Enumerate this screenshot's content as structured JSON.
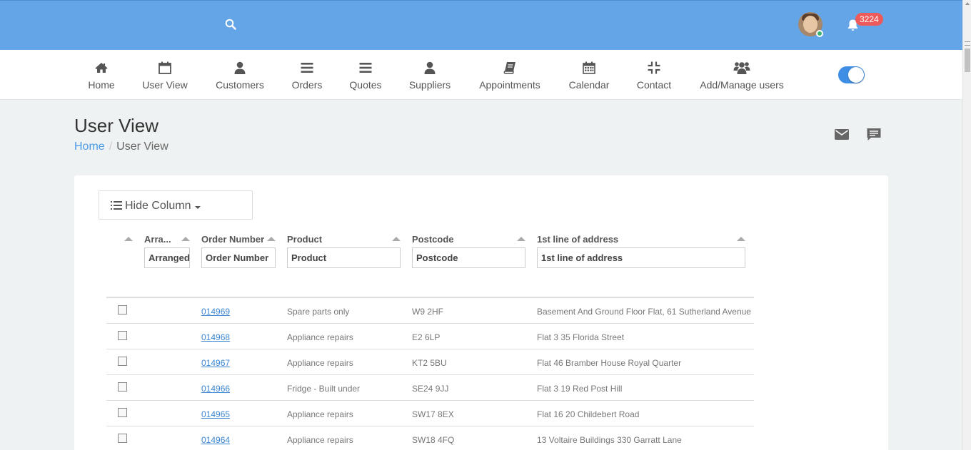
{
  "header": {
    "notification_count": "3224"
  },
  "nav": {
    "items": [
      {
        "label": "Home",
        "icon": "home-icon"
      },
      {
        "label": "User View",
        "icon": "calendar-icon"
      },
      {
        "label": "Customers",
        "icon": "user-icon"
      },
      {
        "label": "Orders",
        "icon": "menu-icon"
      },
      {
        "label": "Quotes",
        "icon": "menu-icon"
      },
      {
        "label": "Suppliers",
        "icon": "user-icon"
      },
      {
        "label": "Appointments",
        "icon": "book-icon"
      },
      {
        "label": "Calendar",
        "icon": "calendar-grid-icon"
      },
      {
        "label": "Contact",
        "icon": "compress-icon"
      },
      {
        "label": "Add/Manage users",
        "icon": "users-icon"
      }
    ]
  },
  "page": {
    "title": "User View",
    "breadcrumb": {
      "home": "Home",
      "current": "User View"
    }
  },
  "toolbar": {
    "hide_column_label": "Hide Column"
  },
  "table": {
    "columns": [
      {
        "header": "Arra...",
        "placeholder": "Arranged"
      },
      {
        "header": "Order Number",
        "placeholder": "Order Number"
      },
      {
        "header": "Product",
        "placeholder": "Product"
      },
      {
        "header": "Postcode",
        "placeholder": "Postcode"
      },
      {
        "header": "1st line of address",
        "placeholder": "1st line of address"
      }
    ],
    "rows": [
      {
        "order": "014969",
        "product": "Spare parts only",
        "postcode": "W9 2HF",
        "address": "Basement And Ground Floor Flat, 61 Sutherland Avenue"
      },
      {
        "order": "014968",
        "product": "Appliance repairs",
        "postcode": "E2 6LP",
        "address": "Flat 3 35 Florida Street"
      },
      {
        "order": "014967",
        "product": "Appliance repairs",
        "postcode": "KT2 5BU",
        "address": "Flat 46 Bramber House Royal Quarter"
      },
      {
        "order": "014966",
        "product": "Fridge - Built under",
        "postcode": "SE24 9JJ",
        "address": "Flat 3 19 Red Post Hill"
      },
      {
        "order": "014965",
        "product": "Appliance repairs",
        "postcode": "SW17 8EX",
        "address": "Flat 16 20 Childebert Road"
      },
      {
        "order": "014964",
        "product": "Appliance repairs",
        "postcode": "SW18 4FQ",
        "address": "13 Voltaire Buildings 330 Garratt Lane"
      }
    ]
  },
  "colors": {
    "topbar": "#63a5e6",
    "accent": "#3f8ee6",
    "badge": "#ee5a5a",
    "link": "#3a86d4"
  }
}
